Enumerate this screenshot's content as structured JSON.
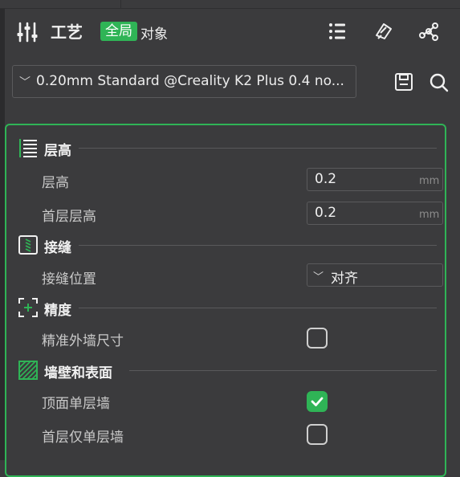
{
  "header": {
    "title": "工艺",
    "scope_global": "全局",
    "scope_object": "对象",
    "icons": [
      "process-settings-icon",
      "list-icon",
      "compare-icon",
      "network-icon"
    ]
  },
  "preset": {
    "value": "0.20mm Standard @Creality K2 Plus 0.4 no...",
    "actions": [
      "save-icon",
      "search-icon"
    ]
  },
  "sections": {
    "layer_height": {
      "title": "层高",
      "icon": "layer-height-icon",
      "rows": [
        {
          "label": "层高",
          "value": "0.2",
          "unit": "mm"
        },
        {
          "label": "首层层高",
          "value": "0.2",
          "unit": "mm"
        }
      ]
    },
    "seam": {
      "title": "接缝",
      "icon": "seam-icon",
      "rows": [
        {
          "label": "接缝位置",
          "value": "对齐"
        }
      ]
    },
    "precision": {
      "title": "精度",
      "icon": "precision-icon",
      "rows": [
        {
          "label": "精准外墙尺寸",
          "checked": false
        }
      ]
    },
    "walls": {
      "title": "墙壁和表面",
      "icon": "walls-surfaces-icon",
      "rows": [
        {
          "label": "顶面单层墙",
          "checked": true
        },
        {
          "label": "首层仅单层墙",
          "checked": false
        }
      ]
    }
  },
  "colors": {
    "accent": "#2fb456",
    "background": "#3b3b3d"
  }
}
